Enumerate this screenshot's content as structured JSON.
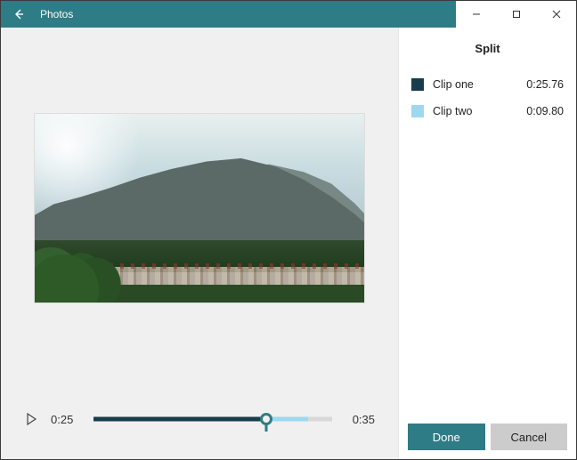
{
  "window": {
    "title": "Photos"
  },
  "timeline": {
    "current_time": "0:25",
    "total_time": "0:35",
    "split_fraction": 0.724,
    "seg2_end_fraction": 0.9
  },
  "panel": {
    "title": "Split",
    "clips": [
      {
        "label": "Clip one",
        "duration": "0:25.76",
        "color": "#173d4a"
      },
      {
        "label": "Clip two",
        "duration": "0:09.80",
        "color": "#9ed8f0"
      }
    ],
    "done_label": "Done",
    "cancel_label": "Cancel"
  },
  "colors": {
    "accent": "#2e7c86"
  }
}
